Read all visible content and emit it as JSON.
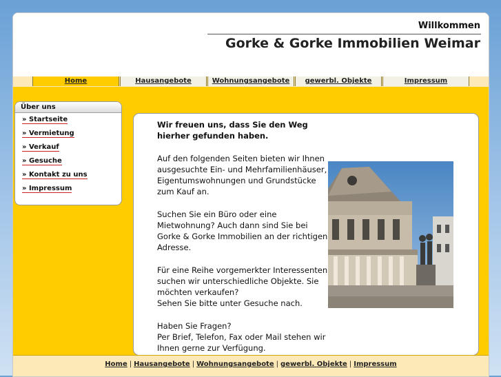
{
  "header": {
    "welcome": "Willkommen",
    "title": "Gorke & Gorke Immobilien Weimar"
  },
  "topnav": [
    {
      "label": "Home",
      "active": true
    },
    {
      "label": "Hausangebote",
      "active": false
    },
    {
      "label": "Wohnungsangebote",
      "active": false
    },
    {
      "label": "gewerbl. Objekte",
      "active": false
    },
    {
      "label": "Impressum",
      "active": false
    }
  ],
  "sidebar": {
    "heading": "Über uns",
    "items": [
      {
        "label": "» Startseite"
      },
      {
        "label": "» Vermietung"
      },
      {
        "label": "» Verkauf"
      },
      {
        "label": "» Gesuche"
      },
      {
        "label": "» Kontakt zu uns"
      },
      {
        "label": "» Impressum"
      }
    ]
  },
  "content": {
    "lead": "Wir freuen uns, dass Sie den Weg hierher gefunden haben.",
    "p1": "Auf den folgenden Seiten bieten wir Ihnen ausgesuchte Ein- und Mehrfamilienhäuser, Eigentumswohnungen und Grundstücke zum Kauf an.",
    "p2": "Suchen Sie ein Büro oder eine Mietwohnung? Auch dann sind Sie bei Gorke & Gorke Immobilien an der richtigen Adresse.",
    "p3a": "Für eine Reihe vorgemerkter Interessenten suchen wir unterschiedliche Objekte. Sie möchten verkaufen?",
    "p3b": "Sehen Sie bitte unter Gesuche nach.",
    "p4a": "Haben Sie Fragen?",
    "p4b": "Per Brief, Telefon, Fax oder Mail stehen wir Ihnen gerne zur Verfügung."
  },
  "footer": {
    "links": [
      "Home",
      "Hausangebote",
      "Wohnungsangebote",
      "gewerbl. Objekte",
      "Impressum"
    ],
    "separator": "|"
  },
  "colors": {
    "accent_yellow": "#ffcc00",
    "nav_bg": "#fce9b7",
    "underline_red": "#cc2020"
  },
  "icons": {
    "photo": "theatre-building-photo"
  }
}
